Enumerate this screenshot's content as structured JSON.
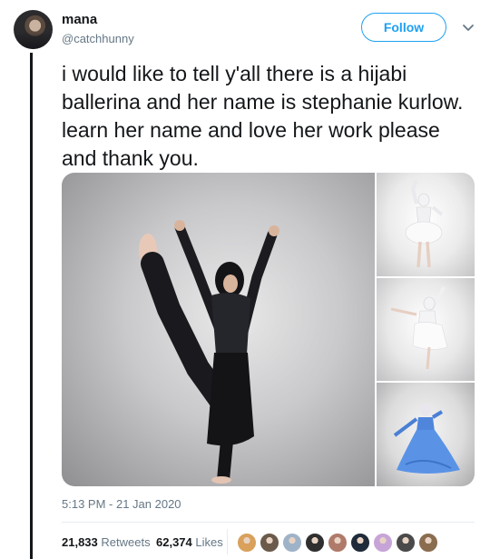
{
  "author": {
    "display_name": "mana",
    "handle": "@catchhunny",
    "avatar_icon": "profile-avatar"
  },
  "actions": {
    "follow_label": "Follow",
    "more_icon": "chevron-down-icon"
  },
  "tweet": {
    "text": "i would like to tell y'all there is a hijabi ballerina and her name is stephanie kurlow. learn her name and love her work please and thank you.",
    "timestamp": "5:13 PM - 21 Jan 2020"
  },
  "media": {
    "photos": [
      {
        "subject": "dancer in black outfit and hijab, leg raised high"
      },
      {
        "subject": "dancer in white tutu, arms raised"
      },
      {
        "subject": "dancer in white dress, arabesque"
      },
      {
        "subject": "dancer in blue flowing dress"
      }
    ]
  },
  "stats": {
    "retweets_count": "21,833",
    "retweets_label": "Retweets",
    "likes_count": "62,374",
    "likes_label": "Likes"
  },
  "likers": [
    {
      "color": "#d9a15c"
    },
    {
      "color": "#6b5a4a"
    },
    {
      "color": "#9fb3c8"
    },
    {
      "color": "#2f2f2f"
    },
    {
      "color": "#b07a6a"
    },
    {
      "color": "#1f2a3a"
    },
    {
      "color": "#c7a4d8"
    },
    {
      "color": "#4a4a4a"
    },
    {
      "color": "#8a6d4f"
    }
  ],
  "colors": {
    "accent": "#1da1f2",
    "text": "#14171a",
    "secondary": "#657786"
  }
}
